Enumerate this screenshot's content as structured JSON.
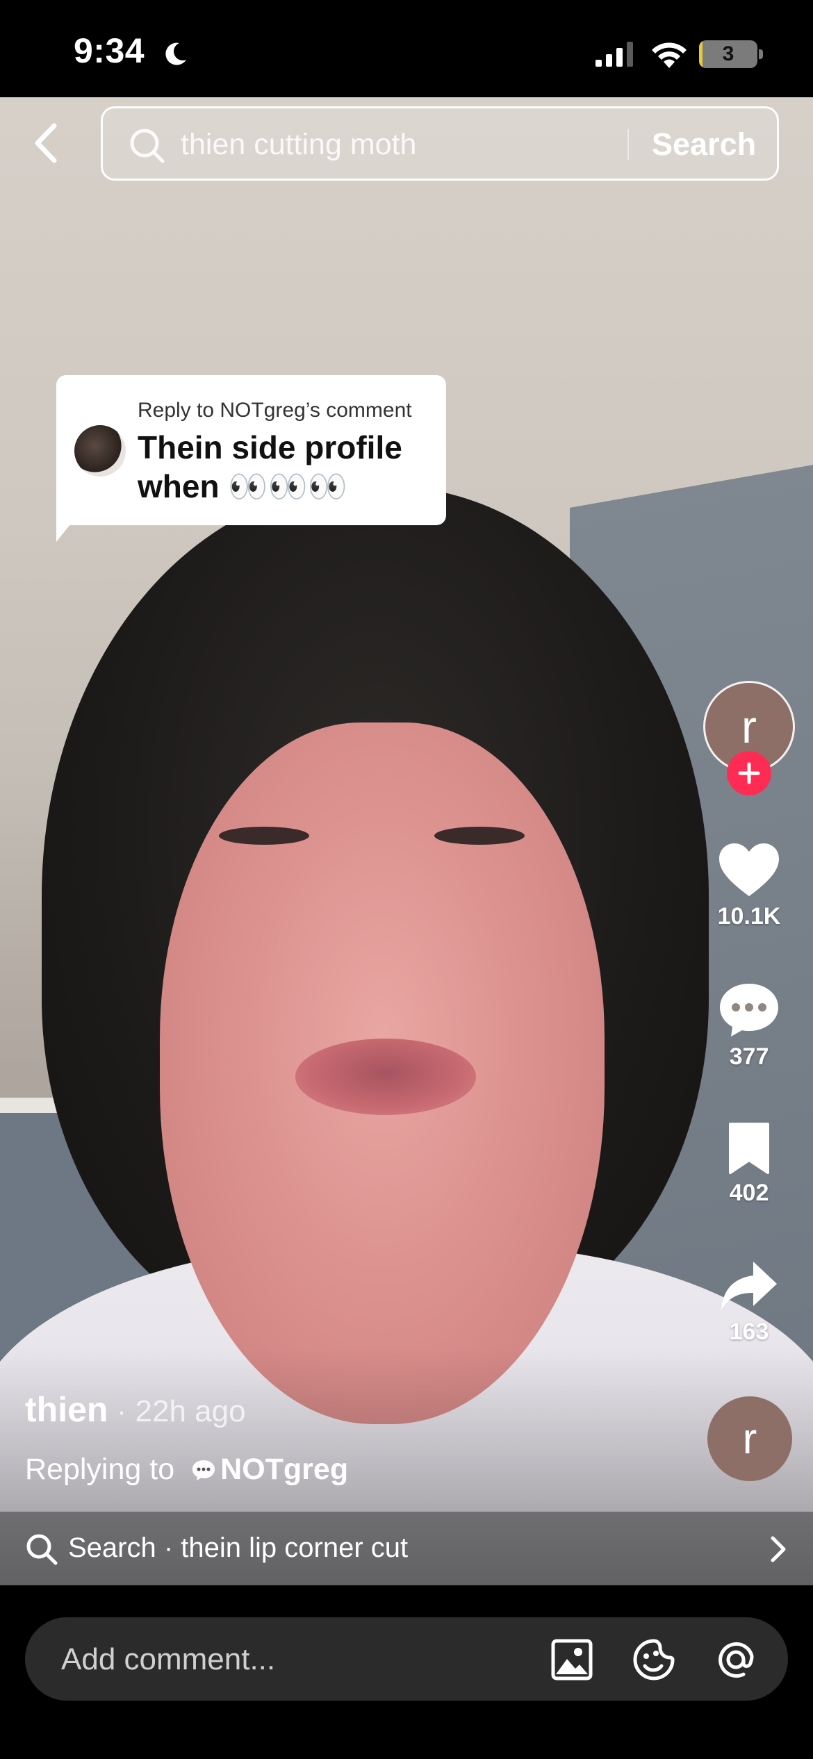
{
  "status_bar": {
    "time": "9:34",
    "battery_level": "3",
    "battery_fraction": 0.06,
    "icons": [
      "moon-icon",
      "signal-icon",
      "wifi-icon",
      "battery-icon"
    ]
  },
  "top_search": {
    "query": "thien cutting moth",
    "submit_label": "Search",
    "icons": [
      "back-icon",
      "search-icon"
    ]
  },
  "reply_sticker": {
    "label": "Reply to NOTgreg’s comment",
    "text": "Thein side profile when 👀👀👀"
  },
  "actions": {
    "avatar_initial": "r",
    "likes": "10.1K",
    "comments": "377",
    "bookmarks": "402",
    "shares": "163",
    "music_initial": "r",
    "icons": [
      "plus-icon",
      "heart-icon",
      "comment-icon",
      "bookmark-icon",
      "share-icon"
    ]
  },
  "post": {
    "author": "thien",
    "time_ago": " · 22h ago",
    "replying_prefix": "Replying to",
    "replying_user": "NOTgreg"
  },
  "related_search": {
    "text": "Search · thein lip corner cut",
    "icons": [
      "search-icon",
      "chevron-right-icon"
    ]
  },
  "comment_bar": {
    "placeholder": "Add comment...",
    "icons": [
      "image-icon",
      "sticker-icon",
      "mention-icon"
    ]
  },
  "colors": {
    "accent": "#fe2c55",
    "battery": "#e7c93d"
  }
}
